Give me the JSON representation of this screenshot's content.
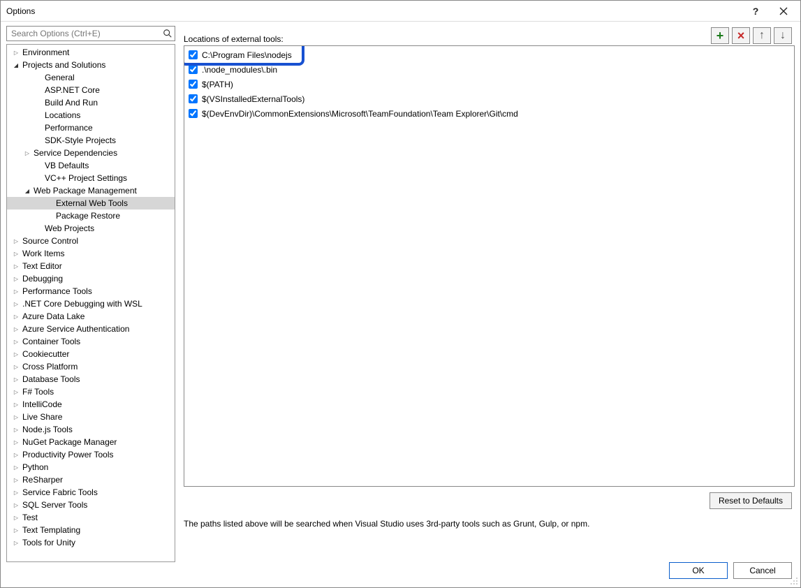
{
  "window": {
    "title": "Options"
  },
  "search": {
    "placeholder": "Search Options (Ctrl+E)"
  },
  "tree": [
    {
      "label": "Environment",
      "depth": 0,
      "state": "collapsed"
    },
    {
      "label": "Projects and Solutions",
      "depth": 0,
      "state": "expanded"
    },
    {
      "label": "General",
      "depth": 1,
      "state": "leaf"
    },
    {
      "label": "ASP.NET Core",
      "depth": 1,
      "state": "leaf"
    },
    {
      "label": "Build And Run",
      "depth": 1,
      "state": "leaf"
    },
    {
      "label": "Locations",
      "depth": 1,
      "state": "leaf"
    },
    {
      "label": "Performance",
      "depth": 1,
      "state": "leaf"
    },
    {
      "label": "SDK-Style Projects",
      "depth": 1,
      "state": "leaf"
    },
    {
      "label": "Service Dependencies",
      "depth": 1,
      "state": "collapsed"
    },
    {
      "label": "VB Defaults",
      "depth": 1,
      "state": "leaf"
    },
    {
      "label": "VC++ Project Settings",
      "depth": 1,
      "state": "leaf"
    },
    {
      "label": "Web Package Management",
      "depth": 1,
      "state": "expanded"
    },
    {
      "label": "External Web Tools",
      "depth": 2,
      "state": "leaf",
      "selected": true
    },
    {
      "label": "Package Restore",
      "depth": 2,
      "state": "leaf"
    },
    {
      "label": "Web Projects",
      "depth": 1,
      "state": "leaf"
    },
    {
      "label": "Source Control",
      "depth": 0,
      "state": "collapsed"
    },
    {
      "label": "Work Items",
      "depth": 0,
      "state": "collapsed"
    },
    {
      "label": "Text Editor",
      "depth": 0,
      "state": "collapsed"
    },
    {
      "label": "Debugging",
      "depth": 0,
      "state": "collapsed"
    },
    {
      "label": "Performance Tools",
      "depth": 0,
      "state": "collapsed"
    },
    {
      "label": ".NET Core Debugging with WSL",
      "depth": 0,
      "state": "collapsed"
    },
    {
      "label": "Azure Data Lake",
      "depth": 0,
      "state": "collapsed"
    },
    {
      "label": "Azure Service Authentication",
      "depth": 0,
      "state": "collapsed"
    },
    {
      "label": "Container Tools",
      "depth": 0,
      "state": "collapsed"
    },
    {
      "label": "Cookiecutter",
      "depth": 0,
      "state": "collapsed"
    },
    {
      "label": "Cross Platform",
      "depth": 0,
      "state": "collapsed"
    },
    {
      "label": "Database Tools",
      "depth": 0,
      "state": "collapsed"
    },
    {
      "label": "F# Tools",
      "depth": 0,
      "state": "collapsed"
    },
    {
      "label": "IntelliCode",
      "depth": 0,
      "state": "collapsed"
    },
    {
      "label": "Live Share",
      "depth": 0,
      "state": "collapsed"
    },
    {
      "label": "Node.js Tools",
      "depth": 0,
      "state": "collapsed"
    },
    {
      "label": "NuGet Package Manager",
      "depth": 0,
      "state": "collapsed"
    },
    {
      "label": "Productivity Power Tools",
      "depth": 0,
      "state": "collapsed"
    },
    {
      "label": "Python",
      "depth": 0,
      "state": "collapsed"
    },
    {
      "label": "ReSharper",
      "depth": 0,
      "state": "collapsed"
    },
    {
      "label": "Service Fabric Tools",
      "depth": 0,
      "state": "collapsed"
    },
    {
      "label": "SQL Server Tools",
      "depth": 0,
      "state": "collapsed"
    },
    {
      "label": "Test",
      "depth": 0,
      "state": "collapsed"
    },
    {
      "label": "Text Templating",
      "depth": 0,
      "state": "collapsed"
    },
    {
      "label": "Tools for Unity",
      "depth": 0,
      "state": "collapsed"
    }
  ],
  "main": {
    "section_label": "Locations of external tools:",
    "paths": [
      {
        "checked": true,
        "path": "C:\\Program Files\\nodejs",
        "highlighted": true
      },
      {
        "checked": true,
        "path": ".\\node_modules\\.bin"
      },
      {
        "checked": true,
        "path": "$(PATH)"
      },
      {
        "checked": true,
        "path": "$(VSInstalledExternalTools)"
      },
      {
        "checked": true,
        "path": "$(DevEnvDir)\\CommonExtensions\\Microsoft\\TeamFoundation\\Team Explorer\\Git\\cmd"
      }
    ],
    "reset_label": "Reset to Defaults",
    "help_text": "The paths listed above will be searched when Visual Studio uses 3rd-party tools such as Grunt, Gulp, or npm."
  },
  "footer": {
    "ok": "OK",
    "cancel": "Cancel"
  }
}
